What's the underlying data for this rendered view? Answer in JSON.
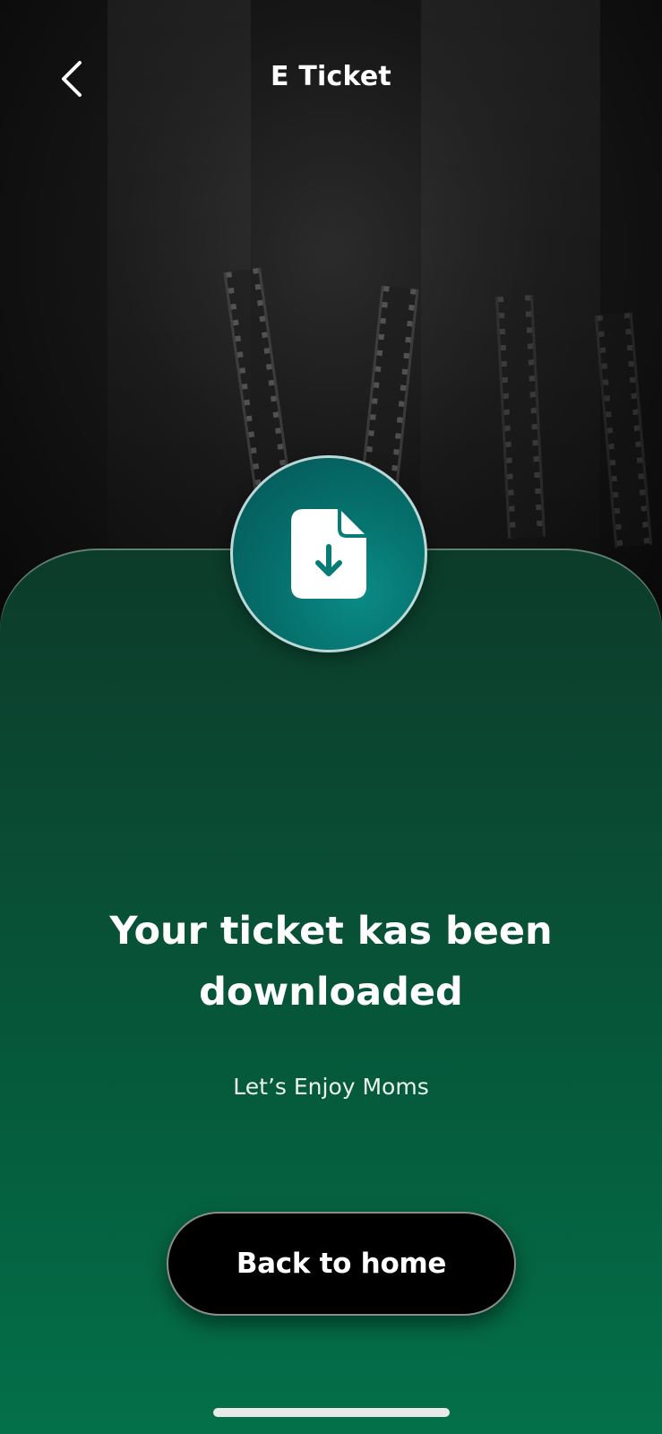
{
  "header": {
    "title": "E Ticket",
    "back_icon": "chevron-left-icon"
  },
  "card": {
    "icon": "file-download-icon",
    "headline": "Your ticket kas been downloaded",
    "subtext": "Let’s Enjoy Moms",
    "button_label": "Back to home"
  },
  "colors": {
    "card_top": "#0c3b2a",
    "card_bottom": "#04704a",
    "circle": "#06706c",
    "button": "#000000",
    "text": "#ffffff"
  }
}
